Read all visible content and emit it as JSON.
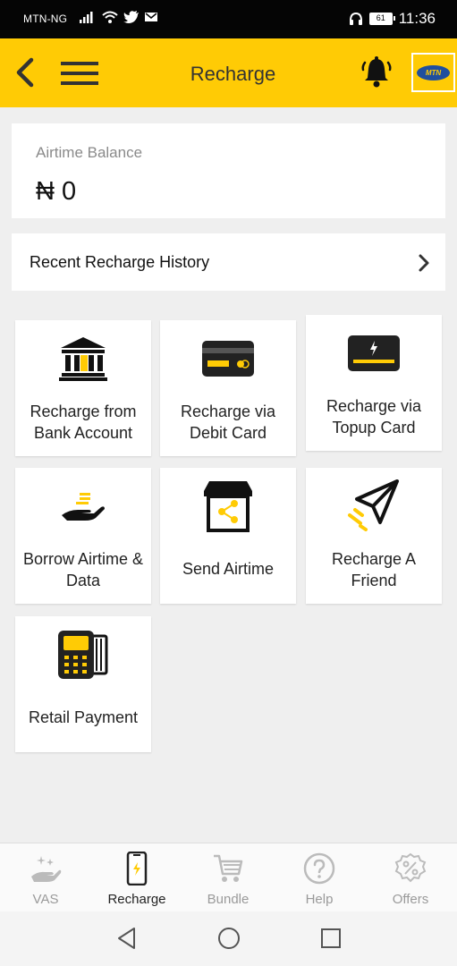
{
  "status_bar": {
    "carrier": "MTN-NG",
    "battery": "61",
    "time": "11:36"
  },
  "header": {
    "title": "Recharge",
    "logo_text": "MTN",
    "brand_color": "#ffcb05"
  },
  "balance": {
    "label": "Airtime Balance",
    "value": "₦ 0"
  },
  "history": {
    "label": "Recent Recharge History"
  },
  "tiles": [
    {
      "label": "Recharge from Bank Account",
      "icon": "bank-icon"
    },
    {
      "label": "Recharge via Debit Card",
      "icon": "debit-card-icon"
    },
    {
      "label": "Recharge via Topup Card",
      "icon": "topup-card-icon"
    },
    {
      "label": "Borrow Airtime & Data",
      "icon": "borrow-hand-icon"
    },
    {
      "label": "Send Airtime",
      "icon": "share-shop-icon"
    },
    {
      "label": "Recharge A Friend",
      "icon": "paper-plane-icon"
    },
    {
      "label": "Retail Payment",
      "icon": "pos-terminal-icon"
    }
  ],
  "bottom_nav": [
    {
      "label": "VAS",
      "icon": "sparkle-hand-icon",
      "active": false
    },
    {
      "label": "Recharge",
      "icon": "phone-charge-icon",
      "active": true
    },
    {
      "label": "Bundle",
      "icon": "cart-icon",
      "active": false
    },
    {
      "label": "Help",
      "icon": "question-icon",
      "active": false
    },
    {
      "label": "Offers",
      "icon": "percent-badge-icon",
      "active": false
    }
  ]
}
